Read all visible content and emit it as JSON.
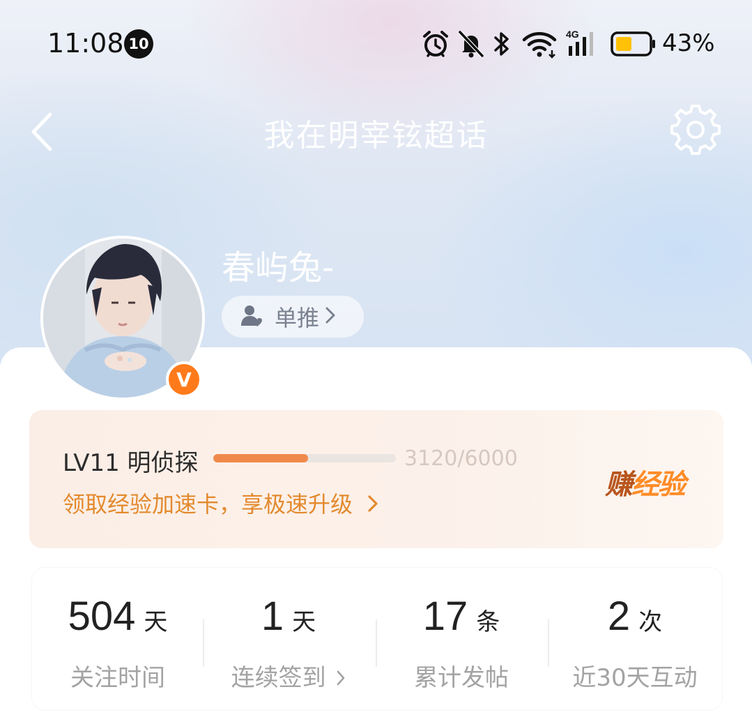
{
  "status_bar": {
    "time": "11:08",
    "notification_count": "10",
    "battery_percent": "43%",
    "network": "4G"
  },
  "nav": {
    "title": "我在明宰铉超话"
  },
  "profile": {
    "username": "春屿兔-",
    "fan_tag_label": "单推",
    "verified_badge": "V"
  },
  "level": {
    "label": "LV11 明侦探",
    "progress_text": "3120/6000",
    "progress_fraction": 0.52,
    "promo_text": "领取经验加速卡，享极速升级",
    "earn_button_first": "赚",
    "earn_button_rest": "经验"
  },
  "stats": [
    {
      "value": "504",
      "unit": "天",
      "label": "关注时间"
    },
    {
      "value": "1",
      "unit": "天",
      "label": "连续签到"
    },
    {
      "value": "17",
      "unit": "条",
      "label": "累计发帖"
    },
    {
      "value": "2",
      "unit": "次",
      "label": "近30天互动"
    }
  ],
  "colors": {
    "accent_orange": "#ff7a1a",
    "progress": "#f08a4b",
    "promo_text": "#e38a2e",
    "battery_fill": "#ffc107"
  }
}
